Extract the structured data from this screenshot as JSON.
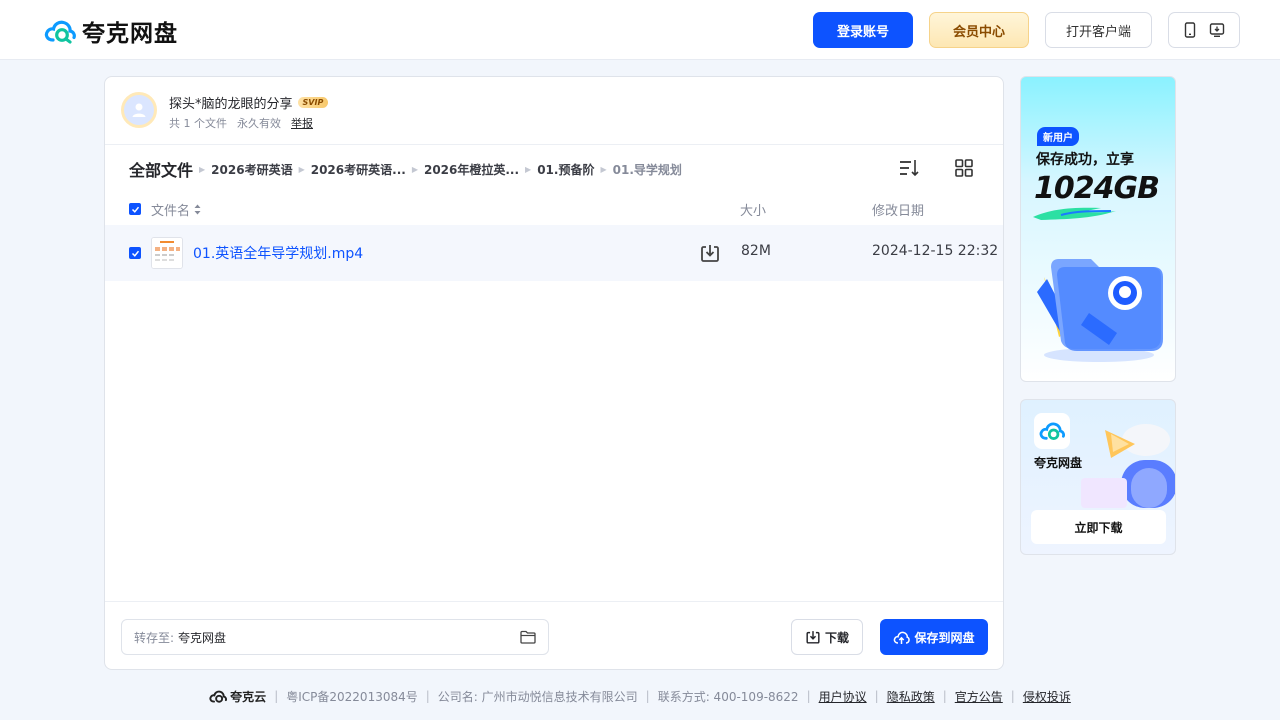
{
  "header": {
    "logo_text": "夸克网盘",
    "login_label": "登录账号",
    "vip_label": "会员中心",
    "client_label": "打开客户端"
  },
  "share": {
    "sharer_name": "探头*脑的龙眼的分享",
    "badge": "SVIP",
    "file_count": "共 1 个文件",
    "validity": "永久有效",
    "report_label": "举报"
  },
  "breadcrumb": {
    "root": "全部文件",
    "items": [
      "2026考研英语",
      "2026考研英语...",
      "2026年橙拉英...",
      "01.预备阶"
    ],
    "current": "01.导学规划"
  },
  "table": {
    "headers": {
      "name": "文件名",
      "size": "大小",
      "date": "修改日期"
    },
    "rows": [
      {
        "name": "01.英语全年导学规划.mp4",
        "size": "82M",
        "date": "2024-12-15 22:32"
      }
    ]
  },
  "actions": {
    "save_to_label": "转存至:",
    "save_to_value": "夸克网盘",
    "download_label": "下载",
    "save_label": "保存到网盘"
  },
  "ads": {
    "ad1_tag": "新用户",
    "ad1_line1": "保存成功，立享",
    "ad1_big": "1024GB",
    "ad2_name": "夸克网盘",
    "ad2_button": "立即下载"
  },
  "footer": {
    "brand": "夸克云",
    "icp": "粤ICP备2022013084号",
    "company": "公司名: 广州市动悦信息技术有限公司",
    "contact": "联系方式: 400-109-8622",
    "links": [
      "用户协议",
      "隐私政策",
      "官方公告",
      "侵权投诉"
    ]
  },
  "colors": {
    "primary": "#0d53ff",
    "vip": "#fde7b3",
    "background": "#f2f6fc"
  }
}
